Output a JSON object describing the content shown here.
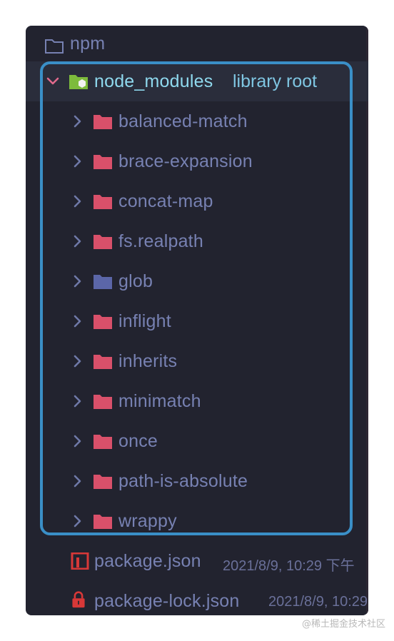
{
  "tree": {
    "project": {
      "label": "npm",
      "icon": "folder-outline-icon"
    },
    "root": {
      "label": "node_modules",
      "suffix": "library root",
      "icon": "library-folder-icon",
      "expanded": true
    },
    "folders": [
      {
        "label": "balanced-match",
        "icon": "folder-icon",
        "color": "#d9506a"
      },
      {
        "label": "brace-expansion",
        "icon": "folder-icon",
        "color": "#d9506a"
      },
      {
        "label": "concat-map",
        "icon": "folder-icon",
        "color": "#d9506a"
      },
      {
        "label": "fs.realpath",
        "icon": "folder-icon",
        "color": "#d9506a"
      },
      {
        "label": "glob",
        "icon": "folder-icon",
        "color": "#5b66a8"
      },
      {
        "label": "inflight",
        "icon": "folder-icon",
        "color": "#d9506a"
      },
      {
        "label": "inherits",
        "icon": "folder-icon",
        "color": "#d9506a"
      },
      {
        "label": "minimatch",
        "icon": "folder-icon",
        "color": "#d9506a"
      },
      {
        "label": "once",
        "icon": "folder-icon",
        "color": "#d9506a"
      },
      {
        "label": "path-is-absolute",
        "icon": "folder-icon",
        "color": "#d9506a"
      },
      {
        "label": "wrappy",
        "icon": "folder-icon",
        "color": "#d9506a"
      }
    ],
    "files": [
      {
        "label": "package.json",
        "meta": "2021/8/9, 10:29 下午",
        "icon": "npm-file-icon"
      },
      {
        "label": "package-lock.json",
        "meta": "2021/8/9, 10:29",
        "icon": "lock-file-icon"
      }
    ]
  },
  "colors": {
    "panel_bg": "#22232f",
    "text": "#7781b2",
    "root_text": "#8fd9ee",
    "highlight_border": "#3a8fc7",
    "folder_red": "#d9506a",
    "folder_blue": "#5b66a8",
    "npm_red": "#d83838"
  },
  "watermark": "@稀土掘金技术社区"
}
